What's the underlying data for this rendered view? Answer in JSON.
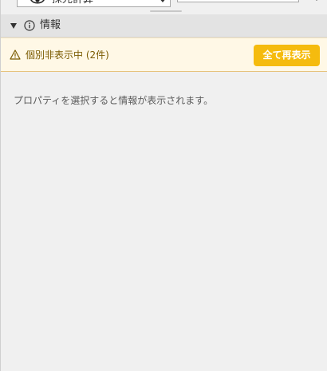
{
  "top_row": {
    "select_value": "採光計算"
  },
  "info_section": {
    "title": "情報"
  },
  "warning_banner": {
    "message": "個別非表示中 (2件)",
    "reshow_all_label": "全て再表示"
  },
  "empty_state": {
    "message": "プロパティを選択すると情報が表示されます。"
  },
  "colors": {
    "banner_bg": "#fff8e6",
    "button_bg": "#f5bb0e",
    "header_bg": "#e3e3e3",
    "panel_bg": "#f0f0f0"
  },
  "icons": {
    "select": "eye-icon",
    "section": "info-circle-icon",
    "banner": "warning-triangle-icon"
  }
}
